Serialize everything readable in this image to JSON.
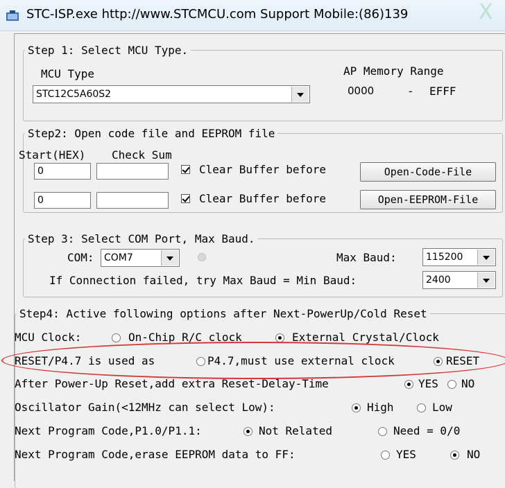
{
  "window": {
    "title": "STC-ISP.exe  http://www.STCMCU.com  Support Mobile:(86)139",
    "stamp_glyph": "X"
  },
  "step1": {
    "legend": "Step 1: Select MCU Type.",
    "mcu_type_label": "MCU Type",
    "mcu_type_value": "STC12C5A60S2",
    "ap_memory_label": "AP Memory Range",
    "ap_start": "0000",
    "ap_dash": "-",
    "ap_end": "EFFF"
  },
  "step2": {
    "legend": "Step2: Open code file and EEPROM file",
    "start_label": "Start(HEX)",
    "checksum_label": "Check Sum",
    "code_start": "0",
    "code_checksum": "",
    "eeprom_start": "0",
    "eeprom_checksum": "",
    "clear_buffer_label": "Clear Buffer before",
    "open_code_button": "Open-Code-File",
    "open_eeprom_button": "Open-EEPROM-File"
  },
  "step3": {
    "legend": "Step 3: Select COM Port, Max Baud.",
    "com_label": "COM:",
    "com_value": "COM7",
    "max_baud_label": "Max Baud:",
    "max_baud_value": "115200",
    "min_baud_label": "If Connection failed, try Max Baud = Min Baud:",
    "min_baud_value": "2400"
  },
  "step4": {
    "legend": "Step4: Active following options after Next-PowerUp/Cold Reset",
    "mcu_clock_label": "MCU Clock:",
    "mcu_clock_opt1": "On-Chip R/C clock",
    "mcu_clock_opt2": "External Crystal/Clock",
    "reset_label": "RESET/P4.7 is used as",
    "reset_opt1": "P4.7,must use external clock",
    "reset_opt2": "RESET",
    "powerup_label": "After Power-Up Reset,add extra Reset-Delay-Time",
    "powerup_yes": "YES",
    "powerup_no": "NO",
    "osc_label": "Oscillator Gain(<12MHz can select Low):",
    "osc_high": "High",
    "osc_low": "Low",
    "p10_label": "Next Program Code,P1.0/P1.1:",
    "p10_opt1": "Not Related",
    "p10_opt2": "Need = 0/0",
    "erase_label": "Next Program Code,erase EEPROM data to FF:",
    "erase_yes": "YES",
    "erase_no": "NO"
  },
  "colors": {
    "highlight": "#d23a3a",
    "titlebar": "#e1ecf6"
  }
}
